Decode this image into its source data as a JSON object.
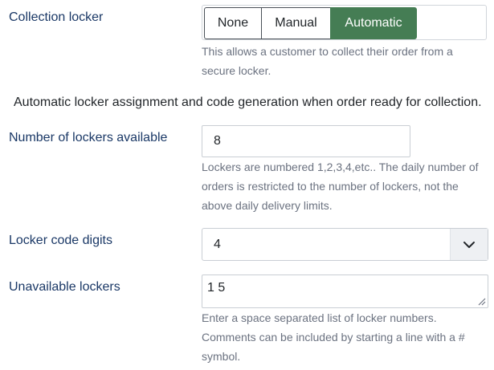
{
  "collection_locker": {
    "label": "Collection locker",
    "options": [
      "None",
      "Manual",
      "Automatic"
    ],
    "selected": "Automatic",
    "help_line1": "This allows a customer to collect their order from a",
    "help_line2": "secure locker."
  },
  "auto_notice": "Automatic locker assignment and code generation when order ready for collection.",
  "lockers_available": {
    "label": "Number of lockers available",
    "value": "8",
    "help_line1": "Lockers are numbered 1,2,3,4,etc.. The daily number of",
    "help_line2": "orders is restricted to the number of lockers, not the",
    "help_line3": "above daily delivery limits."
  },
  "code_digits": {
    "label": "Locker code digits",
    "value": "4",
    "icon": "chevron-down-icon"
  },
  "unavailable_lockers": {
    "label": "Unavailable lockers",
    "value": "1 5",
    "help_line1": "Enter a space separated list of locker numbers.",
    "help_line2": "Comments can be included by starting a line with a #",
    "help_line3": "symbol."
  },
  "colors": {
    "label_text": "#1a3866",
    "active_segment": "#457d54",
    "help_text": "#6b7280"
  }
}
